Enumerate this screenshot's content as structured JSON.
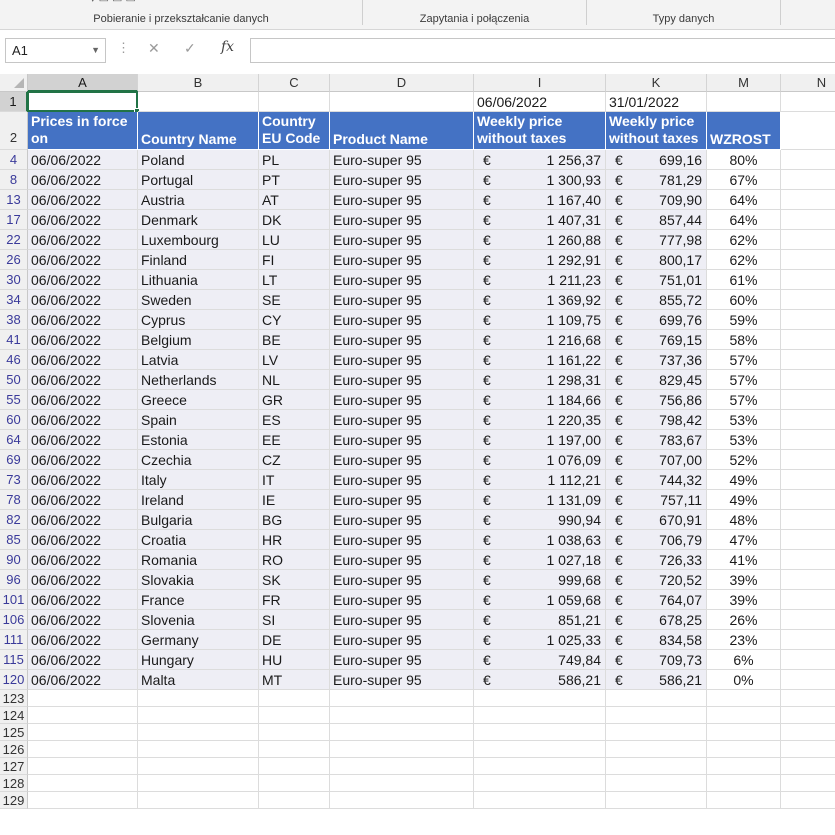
{
  "ribbon": {
    "groups": [
      {
        "label": "Pobieranie i przekształcanie danych"
      },
      {
        "label": "Zapytania i połączenia"
      },
      {
        "label": "Typy danych"
      }
    ]
  },
  "formula_bar": {
    "name_box": "A1",
    "formula": "",
    "fx_label": "fx"
  },
  "colors": {
    "header_fill": "#4472c4",
    "band_fill": "#eeeef5",
    "selection": "#217346"
  },
  "columns": [
    "A",
    "B",
    "C",
    "D",
    "I",
    "K",
    "M",
    "N"
  ],
  "selected_cell": "A1",
  "row1": {
    "date_i": "06/06/2022",
    "date_k": "31/01/2022"
  },
  "header_row": {
    "row_number": "2",
    "prices_in_force": "Prices in force on",
    "country_name": "Country Name",
    "eu_code": "Country EU Code",
    "product_name": "Product Name",
    "weekly_price_i": "Weekly price without taxes",
    "weekly_price_k": "Weekly price without taxes",
    "wzrost": "WZROST"
  },
  "currency_symbol": "€",
  "rows": [
    {
      "n": "4",
      "date": "06/06/2022",
      "country": "Poland",
      "code": "PL",
      "product": "Euro-super 95",
      "p1": "1 256,37",
      "p2": "699,16",
      "pct": "80%"
    },
    {
      "n": "8",
      "date": "06/06/2022",
      "country": "Portugal",
      "code": "PT",
      "product": "Euro-super 95",
      "p1": "1 300,93",
      "p2": "781,29",
      "pct": "67%"
    },
    {
      "n": "13",
      "date": "06/06/2022",
      "country": "Austria",
      "code": "AT",
      "product": "Euro-super 95",
      "p1": "1 167,40",
      "p2": "709,90",
      "pct": "64%"
    },
    {
      "n": "17",
      "date": "06/06/2022",
      "country": "Denmark",
      "code": "DK",
      "product": "Euro-super 95",
      "p1": "1 407,31",
      "p2": "857,44",
      "pct": "64%"
    },
    {
      "n": "22",
      "date": "06/06/2022",
      "country": "Luxembourg",
      "code": "LU",
      "product": "Euro-super 95",
      "p1": "1 260,88",
      "p2": "777,98",
      "pct": "62%"
    },
    {
      "n": "26",
      "date": "06/06/2022",
      "country": "Finland",
      "code": "FI",
      "product": "Euro-super 95",
      "p1": "1 292,91",
      "p2": "800,17",
      "pct": "62%"
    },
    {
      "n": "30",
      "date": "06/06/2022",
      "country": "Lithuania",
      "code": "LT",
      "product": "Euro-super 95",
      "p1": "1 211,23",
      "p2": "751,01",
      "pct": "61%"
    },
    {
      "n": "34",
      "date": "06/06/2022",
      "country": "Sweden",
      "code": "SE",
      "product": "Euro-super 95",
      "p1": "1 369,92",
      "p2": "855,72",
      "pct": "60%"
    },
    {
      "n": "38",
      "date": "06/06/2022",
      "country": "Cyprus",
      "code": "CY",
      "product": "Euro-super 95",
      "p1": "1 109,75",
      "p2": "699,76",
      "pct": "59%"
    },
    {
      "n": "41",
      "date": "06/06/2022",
      "country": "Belgium",
      "code": "BE",
      "product": "Euro-super 95",
      "p1": "1 216,68",
      "p2": "769,15",
      "pct": "58%"
    },
    {
      "n": "46",
      "date": "06/06/2022",
      "country": "Latvia",
      "code": "LV",
      "product": "Euro-super 95",
      "p1": "1 161,22",
      "p2": "737,36",
      "pct": "57%"
    },
    {
      "n": "50",
      "date": "06/06/2022",
      "country": "Netherlands",
      "code": "NL",
      "product": "Euro-super 95",
      "p1": "1 298,31",
      "p2": "829,45",
      "pct": "57%"
    },
    {
      "n": "55",
      "date": "06/06/2022",
      "country": "Greece",
      "code": "GR",
      "product": "Euro-super 95",
      "p1": "1 184,66",
      "p2": "756,86",
      "pct": "57%"
    },
    {
      "n": "60",
      "date": "06/06/2022",
      "country": "Spain",
      "code": "ES",
      "product": "Euro-super 95",
      "p1": "1 220,35",
      "p2": "798,42",
      "pct": "53%"
    },
    {
      "n": "64",
      "date": "06/06/2022",
      "country": "Estonia",
      "code": "EE",
      "product": "Euro-super 95",
      "p1": "1 197,00",
      "p2": "783,67",
      "pct": "53%"
    },
    {
      "n": "69",
      "date": "06/06/2022",
      "country": "Czechia",
      "code": "CZ",
      "product": "Euro-super 95",
      "p1": "1 076,09",
      "p2": "707,00",
      "pct": "52%"
    },
    {
      "n": "73",
      "date": "06/06/2022",
      "country": "Italy",
      "code": "IT",
      "product": "Euro-super 95",
      "p1": "1 112,21",
      "p2": "744,32",
      "pct": "49%"
    },
    {
      "n": "78",
      "date": "06/06/2022",
      "country": "Ireland",
      "code": "IE",
      "product": "Euro-super 95",
      "p1": "1 131,09",
      "p2": "757,11",
      "pct": "49%"
    },
    {
      "n": "82",
      "date": "06/06/2022",
      "country": "Bulgaria",
      "code": "BG",
      "product": "Euro-super 95",
      "p1": "990,94",
      "p2": "670,91",
      "pct": "48%"
    },
    {
      "n": "85",
      "date": "06/06/2022",
      "country": "Croatia",
      "code": "HR",
      "product": "Euro-super 95",
      "p1": "1 038,63",
      "p2": "706,79",
      "pct": "47%"
    },
    {
      "n": "90",
      "date": "06/06/2022",
      "country": "Romania",
      "code": "RO",
      "product": "Euro-super 95",
      "p1": "1 027,18",
      "p2": "726,33",
      "pct": "41%"
    },
    {
      "n": "96",
      "date": "06/06/2022",
      "country": "Slovakia",
      "code": "SK",
      "product": "Euro-super 95",
      "p1": "999,68",
      "p2": "720,52",
      "pct": "39%"
    },
    {
      "n": "101",
      "date": "06/06/2022",
      "country": "France",
      "code": "FR",
      "product": "Euro-super 95",
      "p1": "1 059,68",
      "p2": "764,07",
      "pct": "39%"
    },
    {
      "n": "106",
      "date": "06/06/2022",
      "country": "Slovenia",
      "code": "SI",
      "product": "Euro-super 95",
      "p1": "851,21",
      "p2": "678,25",
      "pct": "26%"
    },
    {
      "n": "111",
      "date": "06/06/2022",
      "country": "Germany",
      "code": "DE",
      "product": "Euro-super 95",
      "p1": "1 025,33",
      "p2": "834,58",
      "pct": "23%"
    },
    {
      "n": "115",
      "date": "06/06/2022",
      "country": "Hungary",
      "code": "HU",
      "product": "Euro-super 95",
      "p1": "749,84",
      "p2": "709,73",
      "pct": "6%"
    },
    {
      "n": "120",
      "date": "06/06/2022",
      "country": "Malta",
      "code": "MT",
      "product": "Euro-super 95",
      "p1": "586,21",
      "p2": "586,21",
      "pct": "0%"
    }
  ],
  "empty_rows": [
    "123",
    "124",
    "125",
    "126",
    "127",
    "128",
    "129"
  ]
}
